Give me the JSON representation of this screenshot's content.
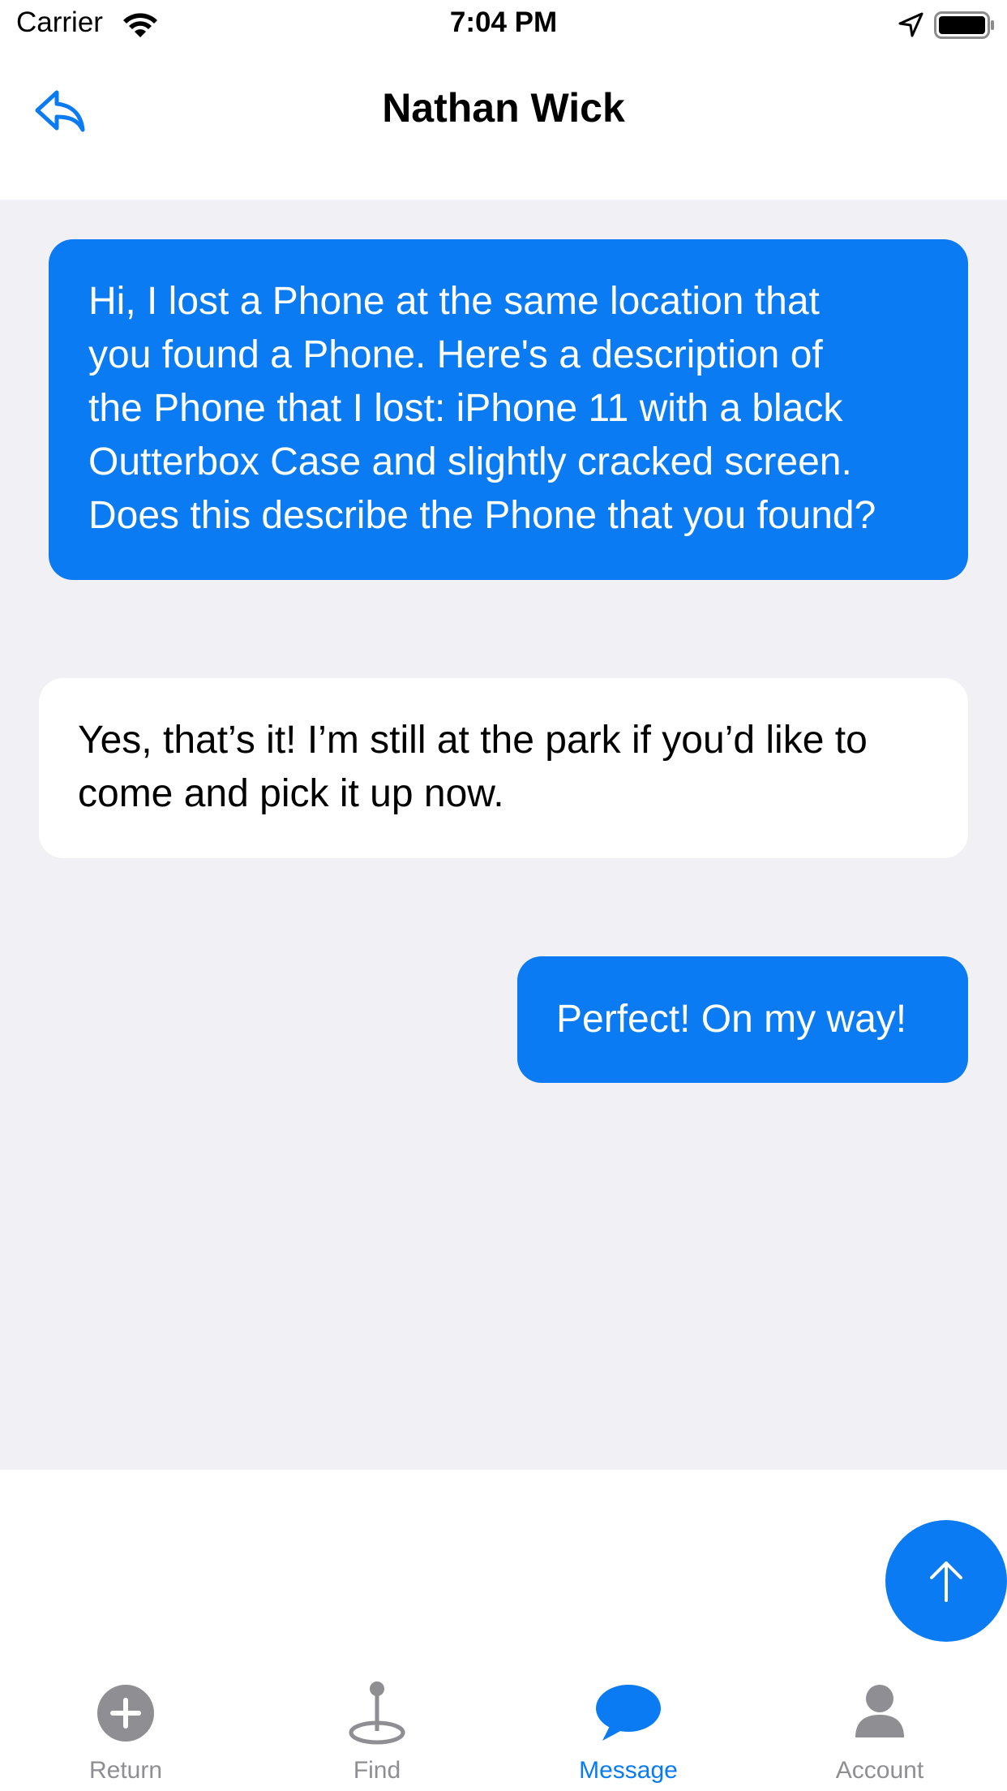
{
  "status_bar": {
    "carrier": "Carrier",
    "time": "7:04 PM",
    "icons": [
      "wifi-icon",
      "location-arrow-icon",
      "battery-icon"
    ]
  },
  "nav": {
    "title": "Nathan Wick",
    "back_icon": "reply-arrow-icon"
  },
  "messages": [
    {
      "direction": "outgoing",
      "lines": [
        "Hi, I lost a Phone at the same location that",
        "you found a Phone. Here's a description of",
        "the Phone that I lost: iPhone 11 with a black",
        "Outterbox Case and slightly cracked screen.",
        "Does this describe the Phone that you found?"
      ]
    },
    {
      "direction": "incoming",
      "lines": [
        "Yes, that’s it! I’m still at the park if you’d like to",
        "come and pick it up now."
      ]
    },
    {
      "direction": "outgoing",
      "lines": [
        "Perfect! On my way!"
      ]
    }
  ],
  "composer": {
    "send_icon": "arrow-up-icon"
  },
  "tabs": [
    {
      "label": "Return",
      "icon": "plus-circle-icon",
      "active": false
    },
    {
      "label": "Find",
      "icon": "map-pin-icon",
      "active": false
    },
    {
      "label": "Message",
      "icon": "chat-bubble-icon",
      "active": true
    },
    {
      "label": "Account",
      "icon": "person-icon",
      "active": false
    }
  ],
  "colors": {
    "accent": "#0a7bf2",
    "chat_background": "#f0f0f5",
    "inactive_tab": "#8e8e93"
  }
}
